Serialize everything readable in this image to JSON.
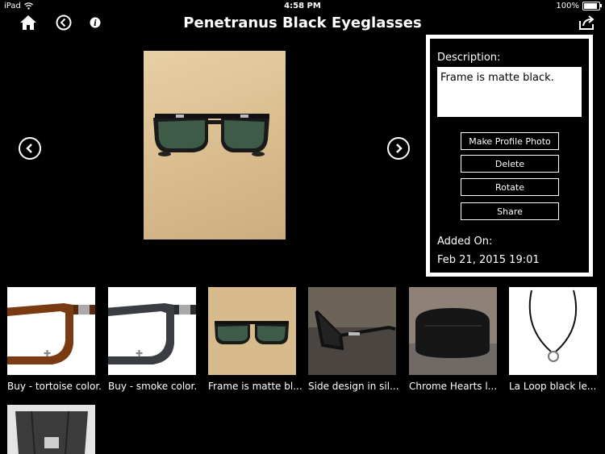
{
  "status_bar": {
    "device": "iPad",
    "time": "4:58 PM",
    "battery": "100%",
    "battery_level": 1.0
  },
  "header": {
    "title": "Penetranus Black Eyeglasses"
  },
  "icons": {
    "home": "home-icon",
    "back": "back-circle-icon",
    "info": "info-icon",
    "share": "share-icon",
    "prev": "chevron-left-circle-icon",
    "next": "chevron-right-circle-icon"
  },
  "panel": {
    "description_label": "Description:",
    "description_value": "Frame is matte black.",
    "buttons": [
      "Make Profile Photo",
      "Delete",
      "Rotate",
      "Share"
    ],
    "added_on_label": "Added On:",
    "added_on_value": "Feb 21, 2015 19:01"
  },
  "thumbnails": [
    {
      "caption": "Buy - tortoise color."
    },
    {
      "caption": "Buy - smoke color."
    },
    {
      "caption": "Frame is matte bl..."
    },
    {
      "caption": "Side design in sil..."
    },
    {
      "caption": "Chrome Hearts l..."
    },
    {
      "caption": "La Loop black le..."
    },
    {
      "caption": ""
    }
  ],
  "colors": {
    "background": "#000000",
    "foreground": "#ffffff",
    "wood": "#d8bb8c"
  }
}
